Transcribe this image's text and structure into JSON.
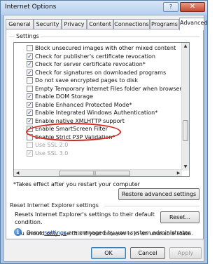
{
  "window": {
    "title": "Internet Options",
    "help_glyph": "?",
    "close_glyph": "✕"
  },
  "tabs": [
    "General",
    "Security",
    "Privacy",
    "Content",
    "Connections",
    "Programs",
    "Advanced"
  ],
  "active_tab": "Advanced",
  "settings": {
    "group_label": "Settings",
    "items": [
      {
        "label": "Block unsecured images with other mixed content",
        "checked": false,
        "disabled": false
      },
      {
        "label": "Check for publisher's certificate revocation",
        "checked": true,
        "disabled": false
      },
      {
        "label": "Check for server certificate revocation*",
        "checked": true,
        "disabled": false
      },
      {
        "label": "Check for signatures on downloaded programs",
        "checked": true,
        "disabled": false
      },
      {
        "label": "Do not save encrypted pages to disk",
        "checked": false,
        "disabled": false
      },
      {
        "label": "Empty Temporary Internet Files folder when browser is cl",
        "checked": false,
        "disabled": false
      },
      {
        "label": "Enable DOM Storage",
        "checked": true,
        "disabled": false
      },
      {
        "label": "Enable Enhanced Protected Mode*",
        "checked": true,
        "disabled": false
      },
      {
        "label": "Enable Integrated Windows Authentication*",
        "checked": true,
        "disabled": false
      },
      {
        "label": "Enable native XMLHTTP support",
        "checked": true,
        "disabled": false
      },
      {
        "label": "Enable SmartScreen Filter",
        "checked": true,
        "disabled": false
      },
      {
        "label": "Enable Strict P3P Validation*",
        "checked": false,
        "disabled": false
      },
      {
        "label": "Use SSL 2.0",
        "checked": false,
        "disabled": true
      },
      {
        "label": "Use SSL 3.0",
        "checked": true,
        "disabled": true
      }
    ],
    "restart_note": "*Takes effect after you restart your computer",
    "restore_button": "Restore advanced settings"
  },
  "reset": {
    "group_label": "Reset Internet Explorer settings",
    "description_line1": "Resets Internet Explorer's settings to their default",
    "description_line2": "condition.",
    "reset_button": "Reset...",
    "warning": "You should only use this if your browser is in an unusable state."
  },
  "info": {
    "prefix": "Some ",
    "link": "settings",
    "suffix": " are managed by your system administrator."
  },
  "footer": {
    "ok": "OK",
    "cancel": "Cancel",
    "apply": "Apply"
  }
}
